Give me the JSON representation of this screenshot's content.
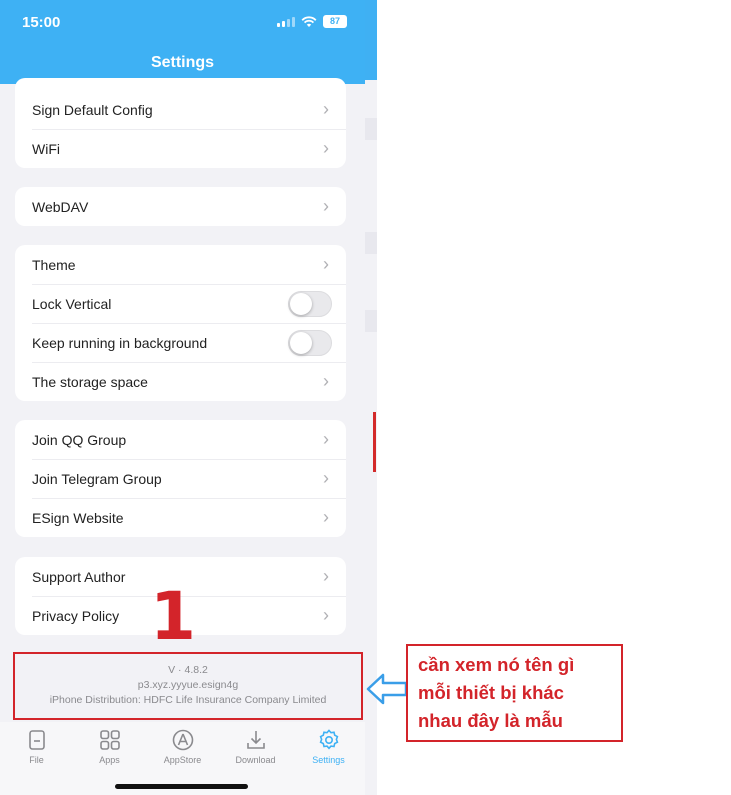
{
  "status_bar": {
    "time": "15:00",
    "battery": "87"
  },
  "header": {
    "title": "Settings"
  },
  "groups": [
    {
      "items": [
        {
          "label": "Sign Default Config"
        },
        {
          "label": "WiFi"
        }
      ]
    },
    {
      "items": [
        {
          "label": "WebDAV"
        }
      ]
    },
    {
      "items": [
        {
          "label": "Theme"
        },
        {
          "label": "Lock Vertical",
          "toggle": false
        },
        {
          "label": "Keep running in background",
          "toggle": false
        },
        {
          "label": "The storage space"
        }
      ]
    },
    {
      "items": [
        {
          "label": "Join QQ Group"
        },
        {
          "label": "Join Telegram Group"
        },
        {
          "label": "ESign Website"
        }
      ]
    },
    {
      "items": [
        {
          "label": "Support Author"
        },
        {
          "label": "Privacy Policy"
        }
      ]
    }
  ],
  "version_info": {
    "version": "V · 4.8.2",
    "bundle_id": "p3.xyz.yyyue.esign4g",
    "distribution": "iPhone Distribution: HDFC Life Insurance Company Limited"
  },
  "tabbar": {
    "tabs": [
      {
        "label": "File",
        "icon": "file-icon"
      },
      {
        "label": "Apps",
        "icon": "apps-grid-icon"
      },
      {
        "label": "AppStore",
        "icon": "appstore-icon"
      },
      {
        "label": "Download",
        "icon": "download-icon"
      },
      {
        "label": "Settings",
        "icon": "gear-icon",
        "active": true
      }
    ]
  },
  "annotation": {
    "marker": "1",
    "note_lines": [
      "cần xem nó tên gì",
      "mỗi thiết bị khác",
      "nhau đây là mẫu"
    ]
  },
  "colors": {
    "accent": "#3eb1f4",
    "annotation_red": "#d3242a",
    "arrow_blue": "#3a9ee8"
  }
}
